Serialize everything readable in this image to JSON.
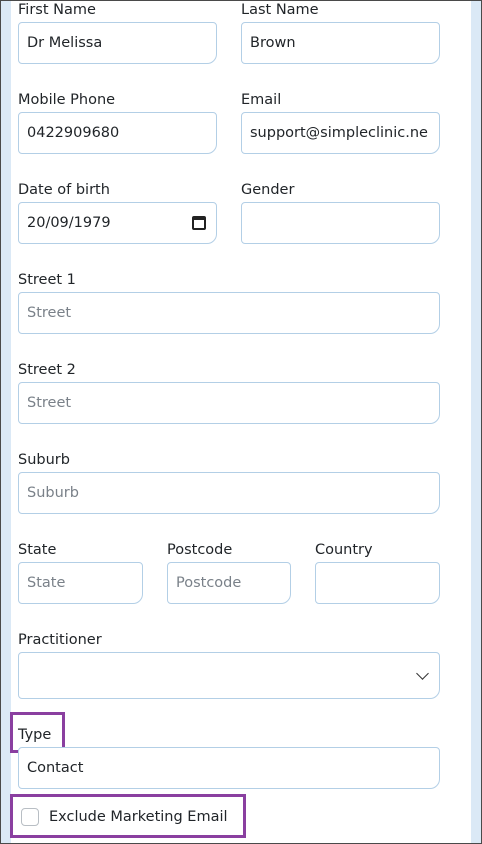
{
  "form": {
    "first_name": {
      "label": "First Name",
      "value": "Dr Melissa"
    },
    "last_name": {
      "label": "Last Name",
      "value": "Brown"
    },
    "mobile_phone": {
      "label": "Mobile Phone",
      "value": "0422909680"
    },
    "email": {
      "label": "Email",
      "value": "support@simpleclinic.ne"
    },
    "date_of_birth": {
      "label": "Date of birth",
      "value": "20/09/1979"
    },
    "gender": {
      "label": "Gender",
      "value": ""
    },
    "street1": {
      "label": "Street 1",
      "placeholder": "Street"
    },
    "street2": {
      "label": "Street 2",
      "placeholder": "Street"
    },
    "suburb": {
      "label": "Suburb",
      "placeholder": "Suburb"
    },
    "state": {
      "label": "State",
      "placeholder": "State"
    },
    "postcode": {
      "label": "Postcode",
      "placeholder": "Postcode"
    },
    "country": {
      "label": "Country",
      "value": ""
    },
    "practitioner": {
      "label": "Practitioner",
      "selected": ""
    },
    "type": {
      "label": "Type",
      "value": "Contact"
    },
    "exclude_marketing": {
      "label": "Exclude Marketing Email",
      "checked": false
    }
  },
  "colors": {
    "highlight": "#8a3fa0",
    "field_border": "#b3cfe6",
    "rail": "#dbe9f6"
  }
}
